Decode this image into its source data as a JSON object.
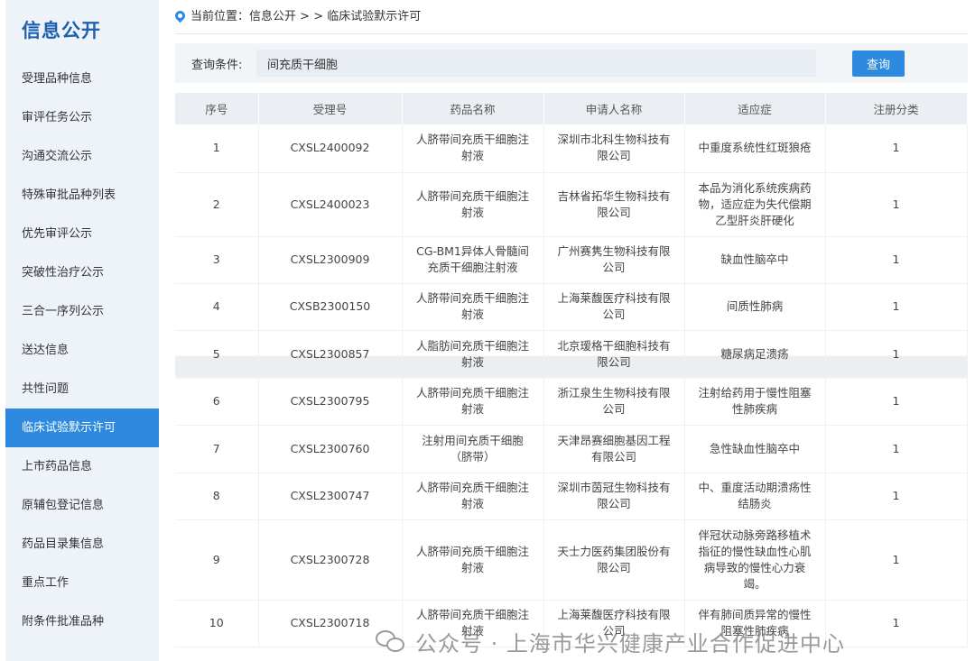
{
  "sidebar": {
    "title": "信息公开",
    "items": [
      {
        "label": "受理品种信息"
      },
      {
        "label": "审评任务公示"
      },
      {
        "label": "沟通交流公示"
      },
      {
        "label": "特殊审批品种列表"
      },
      {
        "label": "优先审评公示"
      },
      {
        "label": "突破性治疗公示"
      },
      {
        "label": "三合一序列公示"
      },
      {
        "label": "送达信息"
      },
      {
        "label": "共性问题"
      },
      {
        "label": "临床试验默示许可",
        "active": true
      },
      {
        "label": "上市药品信息"
      },
      {
        "label": "原辅包登记信息"
      },
      {
        "label": "药品目录集信息"
      },
      {
        "label": "重点工作"
      },
      {
        "label": "附条件批准品种"
      }
    ]
  },
  "breadcrumb": {
    "prefix": "当前位置：",
    "level1": "信息公开",
    "sep": " > > ",
    "current": "临床试验默示许可"
  },
  "query": {
    "label": "查询条件:",
    "value": "间充质干细胞",
    "button": "查询"
  },
  "table": {
    "headers": [
      "序号",
      "受理号",
      "药品名称",
      "申请人名称",
      "适应症",
      "注册分类"
    ],
    "rows": [
      [
        "1",
        "CXSL2400092",
        "人脐带间充质干细胞注射液",
        "深圳市北科生物科技有限公司",
        "中重度系统性红斑狼疮",
        "1"
      ],
      [
        "2",
        "CXSL2400023",
        "人脐带间充质干细胞注射液",
        "吉林省拓华生物科技有限公司",
        "本品为消化系统疾病药物，适应症为失代偿期乙型肝炎肝硬化",
        "1"
      ],
      [
        "3",
        "CXSL2300909",
        "CG-BM1异体人骨髓间充质干细胞注射液",
        "广州赛隽生物科技有限公司",
        "缺血性脑卒中",
        "1"
      ],
      [
        "4",
        "CXSB2300150",
        "人脐带间充质干细胞注射液",
        "上海莱馥医疗科技有限公司",
        "间质性肺病",
        "1"
      ],
      [
        "5",
        "CXSL2300857",
        "人脂肪间充质干细胞注射液",
        "北京瑷格干细胞科技有限公司",
        "糖尿病足溃疡",
        "1"
      ],
      [
        "6",
        "CXSL2300795",
        "人脐带间充质干细胞注射液",
        "浙江泉生生物科技有限公司",
        "注射给药用于慢性阻塞性肺疾病",
        "1"
      ],
      [
        "7",
        "CXSL2300760",
        "注射用间充质干细胞（脐带）",
        "天津昂赛细胞基因工程有限公司",
        "急性缺血性脑卒中",
        "1"
      ],
      [
        "8",
        "CXSL2300747",
        "人脐带间充质干细胞注射液",
        "深圳市茵冠生物科技有限公司",
        "中、重度活动期溃疡性结肠炎",
        "1"
      ],
      [
        "9",
        "CXSL2300728",
        "人脐带间充质干细胞注射液",
        "天士力医药集团股份有限公司",
        "伴冠状动脉旁路移植术指征的慢性缺血性心肌病导致的慢性心力衰竭。",
        "1"
      ],
      [
        "10",
        "CXSL2300718",
        "人脐带间充质干细胞注射液",
        "上海莱馥医疗科技有限公司",
        "伴有肺间质异常的慢性阻塞性肺疾病",
        "1"
      ]
    ]
  },
  "watermark": {
    "text": "公众号 · 上海市华兴健康产业合作促进中心"
  }
}
